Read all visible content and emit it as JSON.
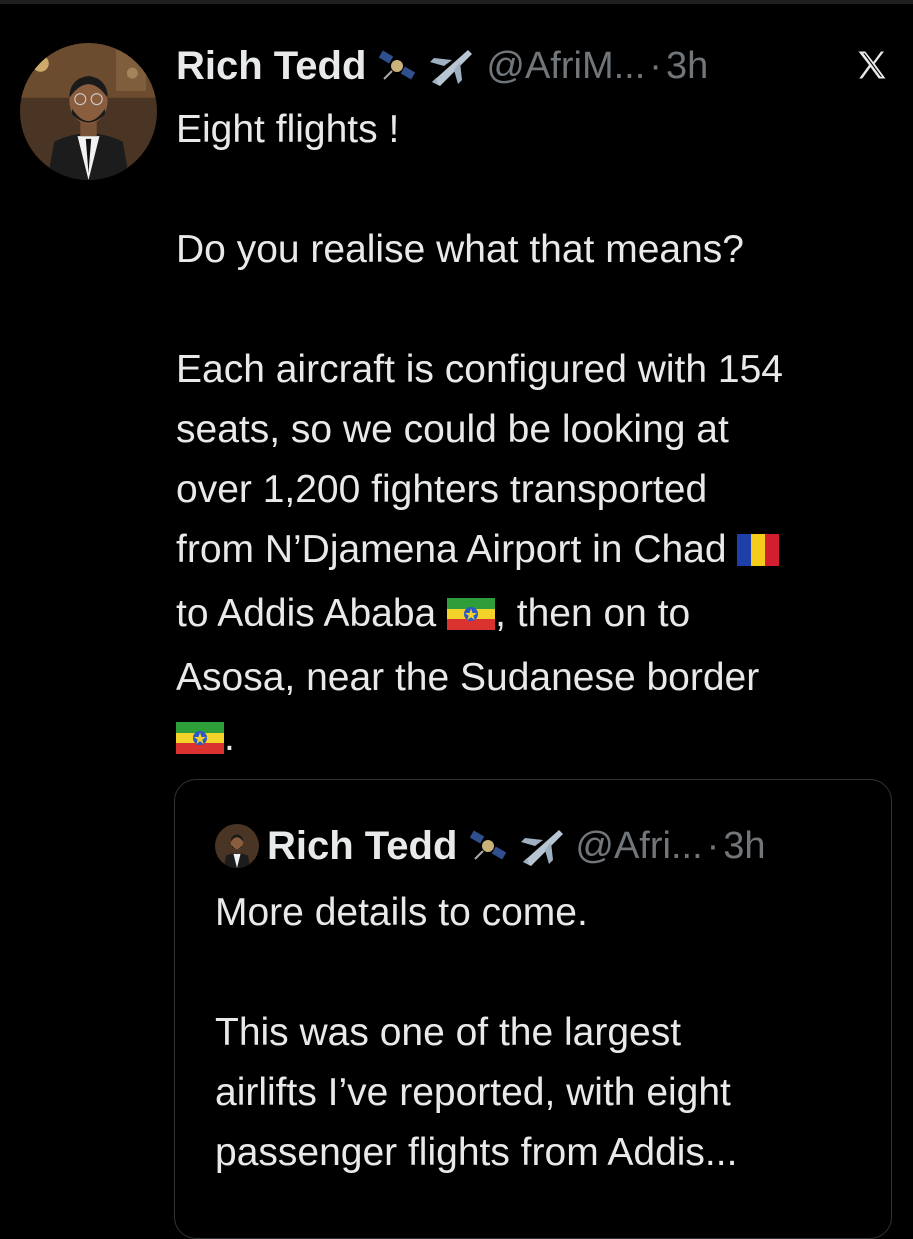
{
  "tweet": {
    "author_name": "Rich Tedd",
    "handle": "@AfriM...",
    "separator": "·",
    "time": "3h",
    "lines": [
      "Eight flights !",
      "",
      "Do you realise what that means?",
      "",
      "Each aircraft is configured with 154",
      "seats, so we could be looking at",
      "over 1,200 fighters transported"
    ],
    "line_chad": "from N’Djamena Airport in Chad",
    "line_addis_a": "to Addis Ababa",
    "line_addis_b": ", then on to",
    "line_asosa": "Asosa, near the Sudanese border",
    "line_end": "."
  },
  "quoted_tweet": {
    "author_name": "Rich Tedd",
    "handle": "@Afri...",
    "separator": "·",
    "time": "3h",
    "lines": [
      "More details to come.",
      "",
      "This was one of the largest",
      "airlifts I’ve reported, with eight",
      "passenger flights from Addis..."
    ]
  },
  "icons": {
    "close": "x-logo-icon",
    "satellite": "satellite-emoji-icon",
    "plane": "airplane-emoji-icon",
    "flag_chad": "chad-flag-icon",
    "flag_ethiopia": "ethiopia-flag-icon"
  },
  "colors": {
    "background": "#000000",
    "text": "#e7e9ea",
    "secondary": "#71767b",
    "border": "#2f3336"
  }
}
